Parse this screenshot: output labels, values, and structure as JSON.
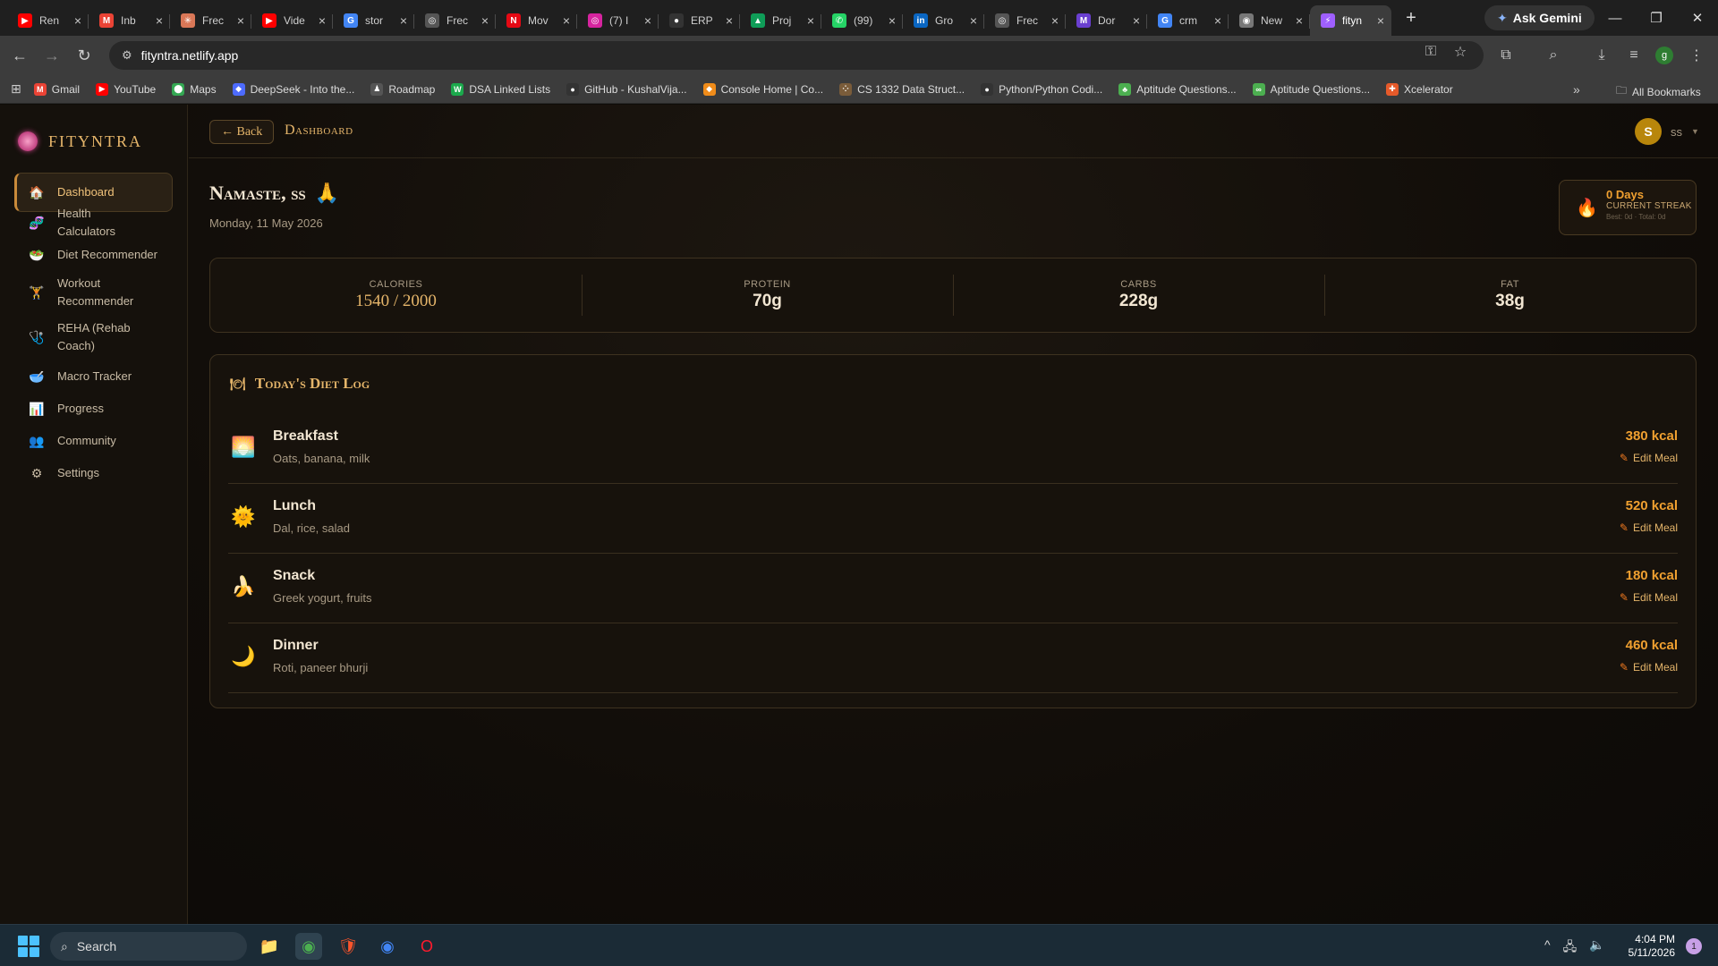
{
  "browser": {
    "tabs": [
      {
        "title": "Ren",
        "icon": "youtube-icon",
        "color": "#ff0000",
        "glyph": "▶"
      },
      {
        "title": "Inb",
        "icon": "gmail-icon",
        "color": "#ea4335",
        "glyph": "M"
      },
      {
        "title": "Frec",
        "icon": "claude-icon",
        "color": "#d97757",
        "glyph": "✳"
      },
      {
        "title": "Vide",
        "icon": "youtube-icon",
        "color": "#ff0000",
        "glyph": "▶"
      },
      {
        "title": "stor",
        "icon": "google-icon",
        "color": "#4285f4",
        "glyph": "G"
      },
      {
        "title": "Frec",
        "icon": "chatgpt-icon",
        "color": "#555555",
        "glyph": "◎"
      },
      {
        "title": "Mov",
        "icon": "netflix-icon",
        "color": "#e50914",
        "glyph": "N"
      },
      {
        "title": "(7) I",
        "icon": "instagram-icon",
        "color": "#d6249f",
        "glyph": "◎"
      },
      {
        "title": "ERP",
        "icon": "github-icon",
        "color": "#333333",
        "glyph": "●"
      },
      {
        "title": "Proj",
        "icon": "drive-icon",
        "color": "#0f9d58",
        "glyph": "▲"
      },
      {
        "title": "(99)",
        "icon": "whatsapp-icon",
        "color": "#25d366",
        "glyph": "✆"
      },
      {
        "title": "Gro",
        "icon": "linkedin-icon",
        "color": "#0a66c2",
        "glyph": "in"
      },
      {
        "title": "Frec",
        "icon": "chatgpt-icon",
        "color": "#555555",
        "glyph": "◎"
      },
      {
        "title": "Dor",
        "icon": "app-icon",
        "color": "#6a3fd0",
        "glyph": "M"
      },
      {
        "title": "crm",
        "icon": "google-icon",
        "color": "#4285f4",
        "glyph": "G"
      },
      {
        "title": "New",
        "icon": "chrome-icon",
        "color": "#777777",
        "glyph": "◉"
      },
      {
        "title": "fityn",
        "icon": "netlify-icon",
        "color": "#9f5fff",
        "glyph": "⚡",
        "active": true
      }
    ],
    "new_tab": "+",
    "ask_gemini": "Ask Gemini",
    "url": "fityntra.netlify.app",
    "bookmarks": [
      {
        "label": "Gmail",
        "color": "#ea4335",
        "glyph": "M"
      },
      {
        "label": "YouTube",
        "color": "#ff0000",
        "glyph": "▶"
      },
      {
        "label": "Maps",
        "color": "#34a853",
        "glyph": "⬤"
      },
      {
        "label": "DeepSeek - Into the...",
        "color": "#4d6bfe",
        "glyph": "◆"
      },
      {
        "label": "Roadmap",
        "color": "#555555",
        "glyph": "♟"
      },
      {
        "label": "DSA Linked Lists",
        "color": "#1ba94c",
        "glyph": "W"
      },
      {
        "label": "GitHub - KushalVija...",
        "color": "#333333",
        "glyph": "●"
      },
      {
        "label": "Console Home | Co...",
        "color": "#f08c1a",
        "glyph": "◆"
      },
      {
        "label": "CS 1332 Data Struct...",
        "color": "#7a5c3a",
        "glyph": "⁘"
      },
      {
        "label": "Python/Python Codi...",
        "color": "#333333",
        "glyph": "●"
      },
      {
        "label": "Aptitude Questions...",
        "color": "#4caf50",
        "glyph": "♣"
      },
      {
        "label": "Aptitude Questions...",
        "color": "#4caf50",
        "glyph": "∞"
      },
      {
        "label": "Xcelerator",
        "color": "#e65a2a",
        "glyph": "✚"
      }
    ],
    "more_bookmarks": "»",
    "all_bookmarks": "All Bookmarks",
    "profile_initial": "g"
  },
  "app": {
    "brand": "FITYNTRA",
    "nav": [
      {
        "label": "Dashboard",
        "icon": "home-icon",
        "glyph": "🏠",
        "active": true
      },
      {
        "label": "Health Calculators",
        "icon": "dna-icon",
        "glyph": "🧬"
      },
      {
        "label": "Diet Recommender",
        "icon": "salad-icon",
        "glyph": "🥗"
      },
      {
        "label": "Workout Recommender",
        "icon": "weightlifter-icon",
        "glyph": "🏋"
      },
      {
        "label": "REHA (Rehab Coach)",
        "icon": "stethoscope-icon",
        "glyph": "🩺"
      },
      {
        "label": "Macro Tracker",
        "icon": "bowl-icon",
        "glyph": "🥣"
      },
      {
        "label": "Progress",
        "icon": "chart-icon",
        "glyph": "📊"
      },
      {
        "label": "Community",
        "icon": "people-icon",
        "glyph": "👥"
      },
      {
        "label": "Settings",
        "icon": "gear-icon",
        "glyph": "⚙"
      }
    ],
    "back_label": "← Back",
    "breadcrumb": "Dashboard",
    "user": {
      "initial": "S",
      "name": "ss"
    },
    "greeting": "Namaste, ss",
    "greeting_emoji": "🙏",
    "date": "Monday, 11 May 2026",
    "streak": {
      "days": "0 Days",
      "label": "CURRENT STREAK",
      "sub": "Best: 0d · Total: 0d"
    },
    "macros": [
      {
        "label": "CALORIES",
        "value": "1540 / 2000",
        "accent": true
      },
      {
        "label": "PROTEIN",
        "value": "70g"
      },
      {
        "label": "CARBS",
        "value": "228g"
      },
      {
        "label": "FAT",
        "value": "38g"
      }
    ],
    "diet_log_title": "Today's Diet Log",
    "meals": [
      {
        "name": "Breakfast",
        "desc": "Oats, banana, milk",
        "kcal": "380 kcal",
        "edit": "Edit Meal",
        "icon": "sunrise-icon",
        "glyph": "🌅"
      },
      {
        "name": "Lunch",
        "desc": "Dal, rice, salad",
        "kcal": "520 kcal",
        "edit": "Edit Meal",
        "icon": "sun-icon",
        "glyph": "🌞"
      },
      {
        "name": "Snack",
        "desc": "Greek yogurt, fruits",
        "kcal": "180 kcal",
        "edit": "Edit Meal",
        "icon": "banana-icon",
        "glyph": "🍌"
      },
      {
        "name": "Dinner",
        "desc": "Roti, paneer bhurji",
        "kcal": "460 kcal",
        "edit": "Edit Meal",
        "icon": "moon-icon",
        "glyph": "🌙"
      }
    ]
  },
  "taskbar": {
    "search_label": "Search",
    "time": "4:04 PM",
    "date": "5/11/2026",
    "notifications": "1"
  }
}
